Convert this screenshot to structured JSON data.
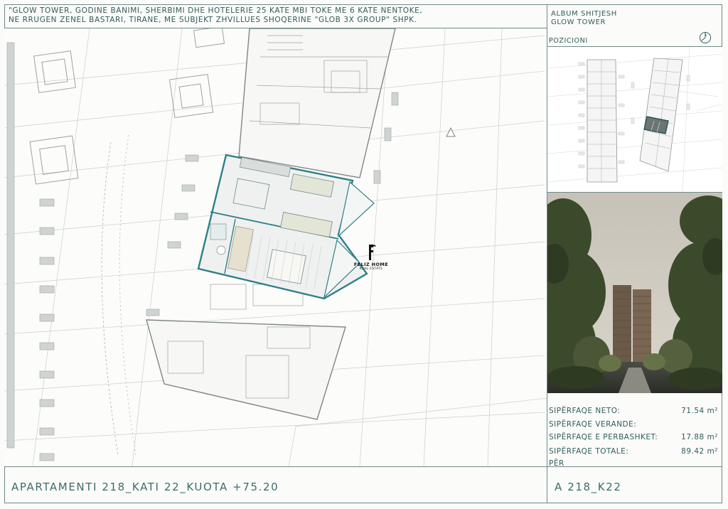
{
  "header": {
    "line1": "\"GLOW TOWER, GODINE BANIMI, SHERBIMI DHE HOTELERIE 25 KATE MBI TOKE ME 6 KATE NENTOKE,",
    "line2": "NE RRUGEN ZENEL BASTARI, TIRANE, ME SUBJEKT ZHVILLUES SHOQERINE \"GLOB 3X GROUP\" SHPK."
  },
  "album": {
    "title": "ALBUM SHITJESH",
    "subtitle": "GLOW TOWER",
    "position_label": "POZICIONI"
  },
  "logo": {
    "name": "FELIZ HOME",
    "tagline": "REAL ESTATE"
  },
  "areas": {
    "neto_label": "SIPËRFAQE NETO:",
    "neto_value": "71.54 m²",
    "verande_label": "SIPËRFAQE VERANDE:",
    "perbashket_label": "SIPËRFAQE E PERBASHKET:",
    "perbashket_value": "17.88 m²",
    "totale_label": "SIPËRFAQE TOTALE:",
    "totale_value": "89.42 m²",
    "per_label": "PËR"
  },
  "footer": {
    "title": "APARTAMENTI 218_KATI 22_KUOTA +75.20",
    "code": "A 218_K22"
  },
  "colors": {
    "line": "#6f8a88",
    "text": "#2f5c5a",
    "highlight": "#2f7f87"
  }
}
